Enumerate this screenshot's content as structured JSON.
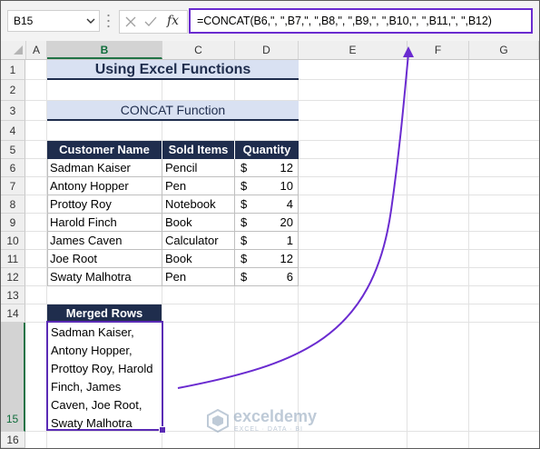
{
  "formula_bar": {
    "name_box": "B15",
    "fx_label": "fx",
    "formula": "=CONCAT(B6,\", \",B7,\", \",B8,\", \",B9,\", \",B10,\", \",B11,\", \",B12)"
  },
  "columns": [
    "A",
    "B",
    "C",
    "D",
    "E",
    "F",
    "G"
  ],
  "rows": [
    "1",
    "2",
    "3",
    "4",
    "5",
    "6",
    "7",
    "8",
    "9",
    "10",
    "11",
    "12",
    "13",
    "14",
    "15",
    "16"
  ],
  "sheet": {
    "title": "Using Excel Functions",
    "subtitle": "CONCAT Function",
    "table": {
      "headers": [
        "Customer Name",
        "Sold Items",
        "Quantity"
      ],
      "currency_symbol": "$",
      "rows": [
        {
          "name": "Sadman Kaiser",
          "item": "Pencil",
          "qty": "12"
        },
        {
          "name": "Antony Hopper",
          "item": "Pen",
          "qty": "10"
        },
        {
          "name": "Prottoy Roy",
          "item": "Notebook",
          "qty": "4"
        },
        {
          "name": "Harold Finch",
          "item": "Book",
          "qty": "20"
        },
        {
          "name": "James Caven",
          "item": "Calculator",
          "qty": "1"
        },
        {
          "name": "Joe Root",
          "item": "Book",
          "qty": "12"
        },
        {
          "name": "Swaty Malhotra",
          "item": "Pen",
          "qty": "6"
        }
      ]
    },
    "merged": {
      "header": "Merged Rows",
      "lines": [
        "Sadman Kaiser,",
        "Antony Hopper,",
        "Prottoy Roy, Harold",
        "Finch, James",
        "Caven, Joe Root,",
        "Swaty Malhotra"
      ]
    }
  },
  "watermark": {
    "name": "exceldemy",
    "tagline": "EXCEL · DATA · BI"
  },
  "colors": {
    "accent": "#6a2bd0",
    "header_fill": "#1f2d4d",
    "title_fill": "#d9e1f2",
    "excel_green": "#217346"
  }
}
